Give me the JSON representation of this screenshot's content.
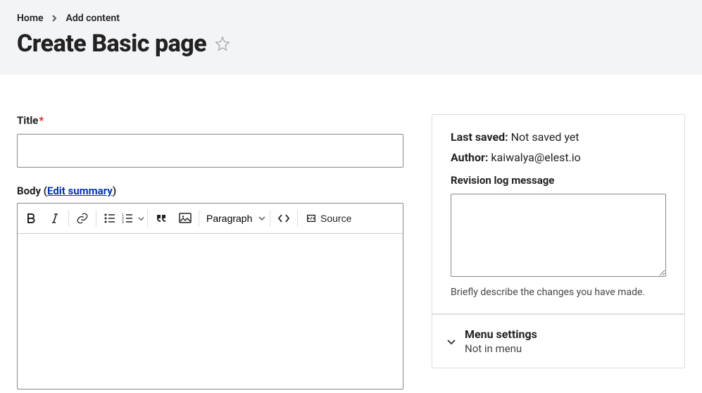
{
  "breadcrumb": {
    "home": "Home",
    "add_content": "Add content"
  },
  "page_title": "Create Basic page",
  "title_field": {
    "label": "Title",
    "value": ""
  },
  "body_field": {
    "label_prefix": "Body (",
    "edit_summary": "Edit summary",
    "label_suffix": ")"
  },
  "toolbar": {
    "heading_option": "Paragraph",
    "source_label": "Source"
  },
  "sidebar": {
    "last_saved_label": "Last saved:",
    "last_saved_value": "Not saved yet",
    "author_label": "Author:",
    "author_value": "kaiwalya@elest.io",
    "revision_label": "Revision log message",
    "revision_value": "",
    "revision_help": "Briefly describe the changes you have made.",
    "menu_settings": {
      "title": "Menu settings",
      "subtitle": "Not in menu"
    }
  }
}
